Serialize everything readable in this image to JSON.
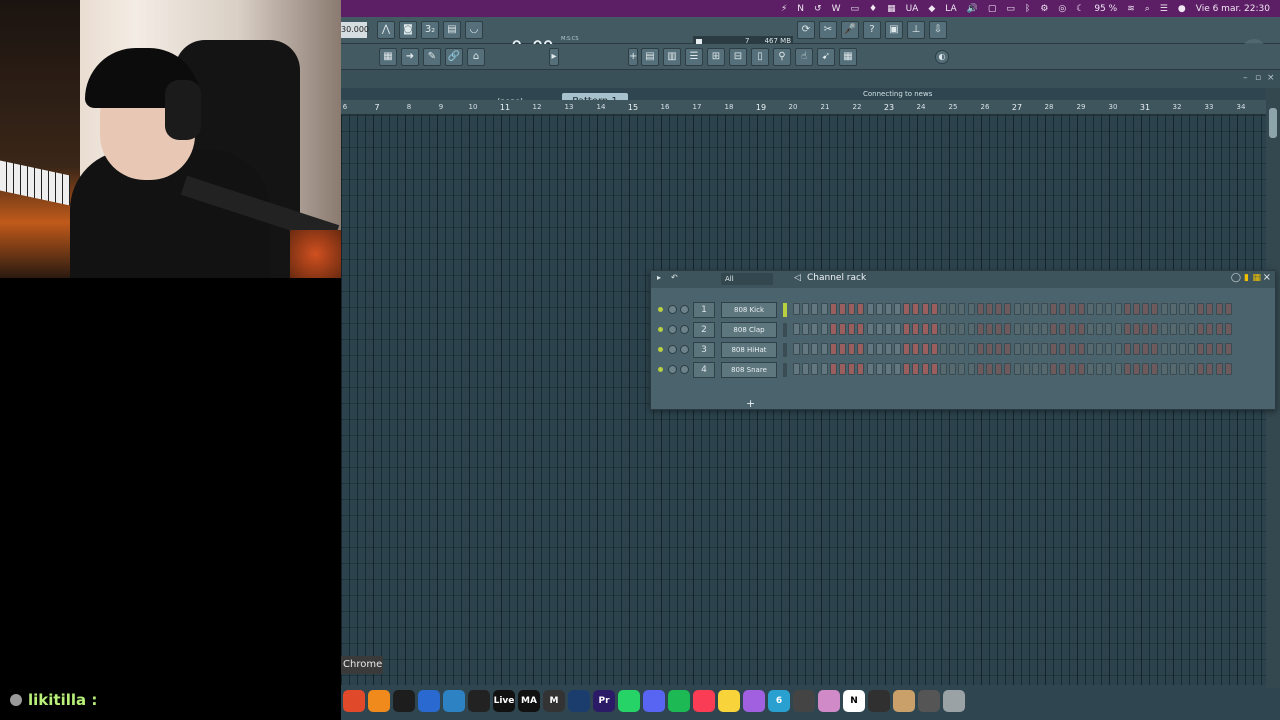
{
  "menubar": {
    "items": [
      "UA",
      "LA",
      "95 %",
      "Vie 6 mar.  22:30"
    ]
  },
  "toolbar": {
    "tempo": "30.000",
    "time": "0:00",
    "time_small": "00",
    "time_unit": "M:S:CS",
    "memory": "467 MB",
    "cpu": "7",
    "polyphony": "1",
    "pattern_none": "(none)",
    "pattern": "Pattern 1",
    "news": "Connecting to news server..."
  },
  "ruler": {
    "marks": [
      "6",
      "7",
      "8",
      "9",
      "10",
      "11",
      "12",
      "13",
      "14",
      "15",
      "16",
      "17",
      "18",
      "19",
      "20",
      "21",
      "22",
      "23",
      "24",
      "25",
      "26",
      "27",
      "28",
      "29",
      "30",
      "31",
      "32",
      "33",
      "34"
    ]
  },
  "channel_rack": {
    "title": "Channel rack",
    "filter": "All",
    "add": "+",
    "channels": [
      {
        "num": "1",
        "name": "808 Kick"
      },
      {
        "num": "2",
        "name": "808 Clap"
      },
      {
        "num": "3",
        "name": "808 HiHat"
      },
      {
        "num": "4",
        "name": "808 Snare"
      }
    ]
  },
  "tooltip": "Chrome",
  "dock": {
    "apps": [
      {
        "name": "chrome",
        "label": "",
        "color": "#e04a2b"
      },
      {
        "name": "fl-studio",
        "label": "",
        "color": "#f08a1c"
      },
      {
        "name": "pen-tool",
        "label": "",
        "color": "#1d1d1d"
      },
      {
        "name": "audio-app",
        "label": "",
        "color": "#2a6ad0"
      },
      {
        "name": "compass",
        "label": "",
        "color": "#2d82c4"
      },
      {
        "name": "app-unity",
        "label": "",
        "color": "#222222"
      },
      {
        "name": "ableton-live",
        "label": "Live",
        "color": "#111111"
      },
      {
        "name": "ma",
        "label": "MA",
        "color": "#111111"
      },
      {
        "name": "maestro",
        "label": "M",
        "color": "#333333"
      },
      {
        "name": "browser",
        "label": "",
        "color": "#1b3d6d"
      },
      {
        "name": "premiere",
        "label": "Pr",
        "color": "#2b1a66"
      },
      {
        "name": "whatsapp",
        "label": "",
        "color": "#25d366"
      },
      {
        "name": "discord",
        "label": "",
        "color": "#5865f2"
      },
      {
        "name": "spotify",
        "label": "",
        "color": "#1db954"
      },
      {
        "name": "music",
        "label": "",
        "color": "#fa3c55"
      },
      {
        "name": "notes",
        "label": "",
        "color": "#f8d33a"
      },
      {
        "name": "lamp",
        "label": "",
        "color": "#a060e0"
      },
      {
        "name": "six",
        "label": "6",
        "color": "#2aa0d0"
      },
      {
        "name": "calculator",
        "label": "",
        "color": "#444444"
      },
      {
        "name": "launchpad",
        "label": "",
        "color": "#d08ac8"
      },
      {
        "name": "notion",
        "label": "N",
        "color": "#ffffff"
      },
      {
        "name": "obs",
        "label": "",
        "color": "#303030"
      },
      {
        "name": "finder",
        "label": "",
        "color": "#c9a06a"
      },
      {
        "name": "folder",
        "label": "",
        "color": "#555555"
      },
      {
        "name": "trash",
        "label": "",
        "color": "#9aa2a6"
      }
    ]
  },
  "chat": {
    "user": "likitilla :",
    "emote": "😂"
  }
}
